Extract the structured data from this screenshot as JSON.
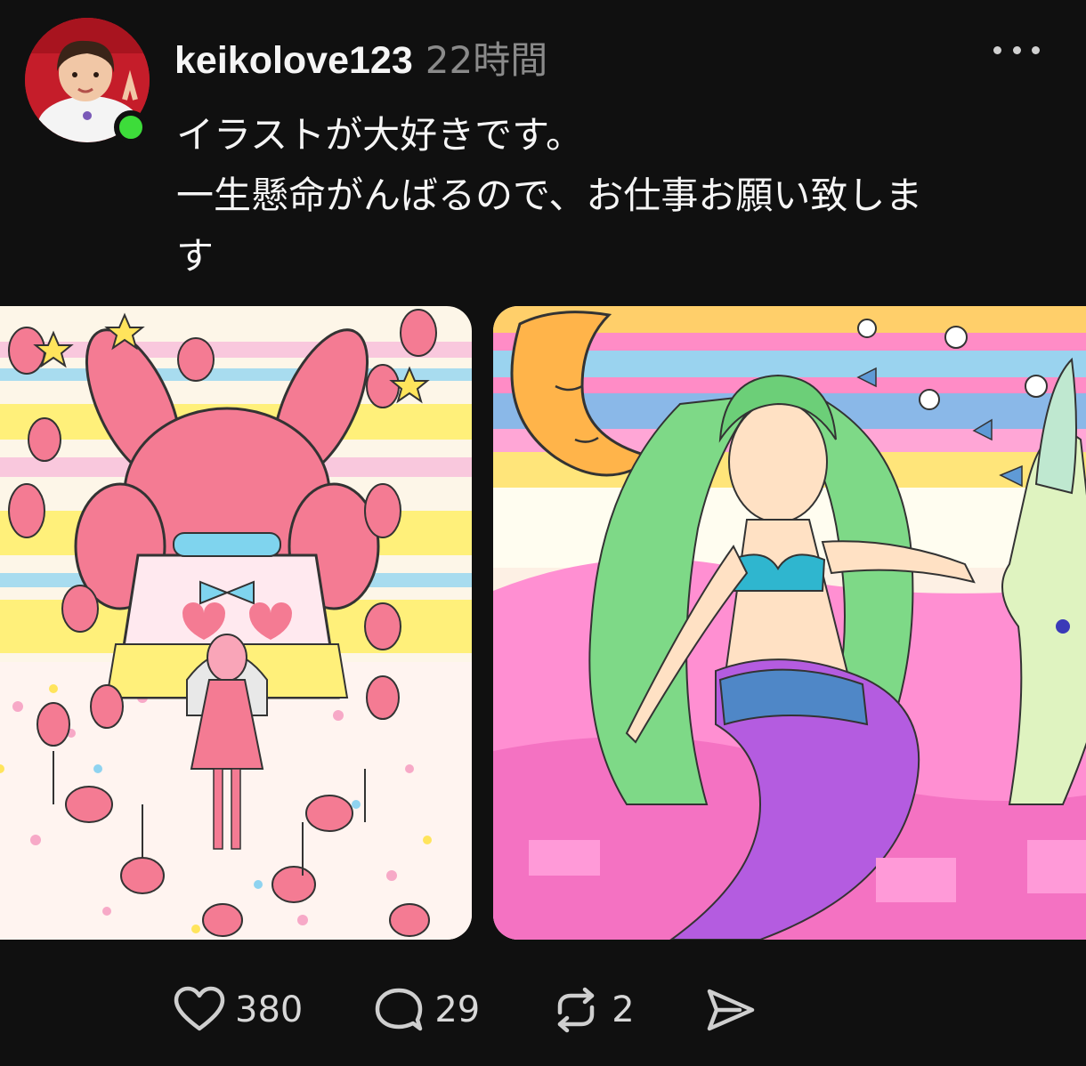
{
  "post": {
    "username": "keikolove123",
    "timestamp": "22時間",
    "text_lines": [
      "イラストが大好きです。",
      "一生懸命がんばるので、お仕事お願い致しま",
      "す"
    ]
  },
  "actions": {
    "likes": "380",
    "replies": "29",
    "reposts": "2"
  },
  "colors": {
    "background": "#101010",
    "online_status": "#3ddc3a",
    "muted_text": "#8a8a8a"
  },
  "icons": [
    "more-icon",
    "heart-icon",
    "comment-icon",
    "repost-icon",
    "send-icon"
  ]
}
